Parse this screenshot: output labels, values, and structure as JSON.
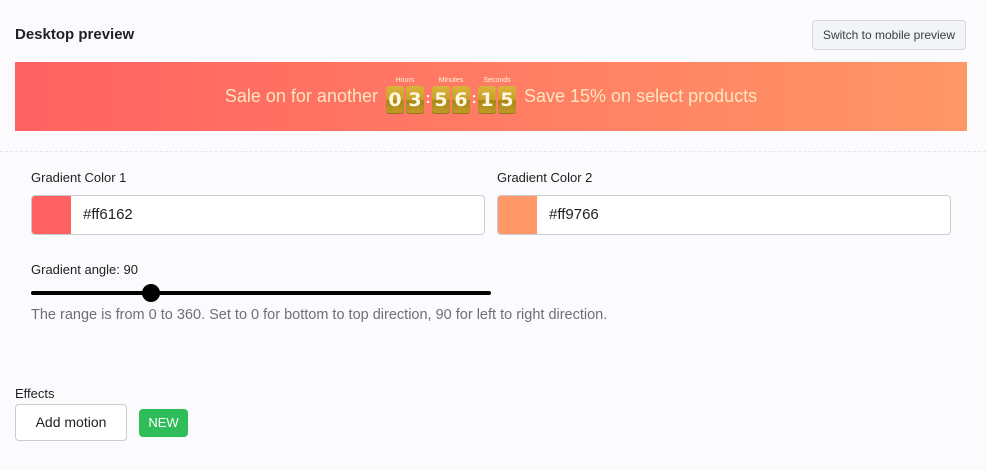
{
  "header": {
    "title": "Desktop preview",
    "switch_label": "Switch to mobile preview"
  },
  "banner": {
    "colors": {
      "start": "#ff6162",
      "end": "#ff9766"
    },
    "text_before": "Sale on for another",
    "text_after": "Save 15% on select products",
    "timer": {
      "hours_label": "Hours",
      "minutes_label": "Minutes",
      "seconds_label": "Seconds",
      "hours": [
        "0",
        "3"
      ],
      "minutes": [
        "5",
        "6"
      ],
      "seconds": [
        "1",
        "5"
      ],
      "separator": ":"
    }
  },
  "gradient": {
    "color1": {
      "label": "Gradient Color 1",
      "value": "#ff6162",
      "swatch": "#ff6162"
    },
    "color2": {
      "label": "Gradient Color 2",
      "value": "#ff9766",
      "swatch": "#ff9766"
    },
    "angle": {
      "label": "Gradient angle: 90",
      "value": 90,
      "min": 0,
      "max": 360,
      "help": "The range is from 0 to 360. Set to 0 for bottom to top direction, 90 for left to right direction."
    }
  },
  "effects": {
    "label": "Effects",
    "motion_button": "Add motion",
    "badge": "NEW",
    "badge_color": "#2ebd59"
  }
}
